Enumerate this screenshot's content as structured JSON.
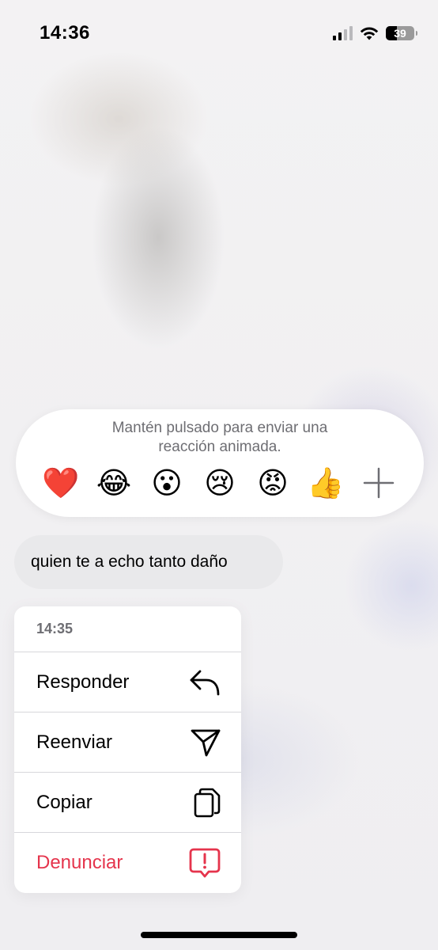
{
  "status_bar": {
    "time": "14:36",
    "battery_level": "39",
    "battery_fraction": 0.39,
    "signal_bars_active": 2,
    "icons": [
      "cellular-signal-icon",
      "wifi-icon",
      "battery-icon"
    ]
  },
  "reactions": {
    "hint": "Mantén pulsado para enviar una reacción animada.",
    "emojis": [
      "❤️",
      "😂",
      "😮",
      "😢",
      "😡",
      "👍"
    ],
    "more_icon": "plus-icon"
  },
  "message": {
    "text": "quien te a echo tanto daño"
  },
  "context_menu": {
    "timestamp": "14:35",
    "items": [
      {
        "label": "Responder",
        "icon": "reply-arrow-icon"
      },
      {
        "label": "Reenviar",
        "icon": "send-paper-plane-icon"
      },
      {
        "label": "Copiar",
        "icon": "copy-icon"
      },
      {
        "label": "Denunciar",
        "icon": "report-icon"
      }
    ]
  },
  "colors": {
    "danger": "#e5344c",
    "bubble": "#e9e9eb",
    "secondary_text": "#6e6e73"
  }
}
